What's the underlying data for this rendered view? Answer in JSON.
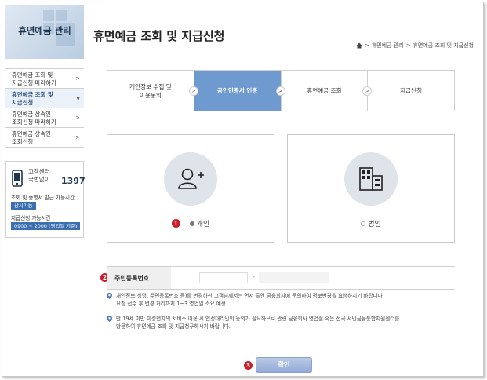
{
  "sidebar": {
    "title": "휴면예금 관리",
    "items": [
      {
        "label": "휴면예금 조회 및\n지급신청 따라하기"
      },
      {
        "label": "휴면예금 조회 및\n지급신청"
      },
      {
        "label": "휴면예금 상속인\n조회신청 따라하기"
      },
      {
        "label": "휴면예금 상속인\n조회신청"
      }
    ],
    "chevron": ">",
    "chevron_active": "v",
    "cs": {
      "label": "고객센터\n국번없이",
      "number": "1397",
      "line1": "조회 및 증명서 발급 가능시간",
      "badge1": "상시가능",
      "line2": "지급신청 가능시간",
      "badge2": "0900 ~ 2000 (영업일 기준)"
    }
  },
  "header": {
    "title": "휴면예금 조회 및 지급신청",
    "breadcrumb": [
      "휴면예금 관리",
      "휴면예금 조회 및 지급신청"
    ],
    "breadcrumb_sep": ">"
  },
  "steps": [
    {
      "label": "개인정보 수집 및\n이용동의"
    },
    {
      "label": "공인인증서 인증"
    },
    {
      "label": "휴면예금 조회"
    },
    {
      "label": "지급신청"
    }
  ],
  "step_arrow": ">",
  "options": {
    "personal": {
      "label": "개인",
      "badge": "1"
    },
    "corporate": {
      "label": "법인"
    }
  },
  "id_field": {
    "label": "주민등록번호",
    "badge": "2",
    "dash": "-"
  },
  "notes": [
    "개인정보(성명, 주민등록번호 등)를 변경하신 고객님께서는 먼저 출연 금융회사에 문의하여 정보변경을 요청하시기 바랍니다.\n요청 접수 후 변경 처리까지 1~3 영업일 소요 예정",
    "만 19세 미만 미성년자의 서비스 이용 시 법정대리인의 동의가 필요하므로 관련 금융회사 영업점 혹은 전국 서민금융통합지원센터를\n방문하여 휴면예금 조회 및 지급청구하시기 바랍니다."
  ],
  "confirm": {
    "label": "확인",
    "badge": "3"
  },
  "colors": {
    "accent": "#6f9acf",
    "badge_red": "#c91e2a",
    "navy": "#1f3550"
  }
}
